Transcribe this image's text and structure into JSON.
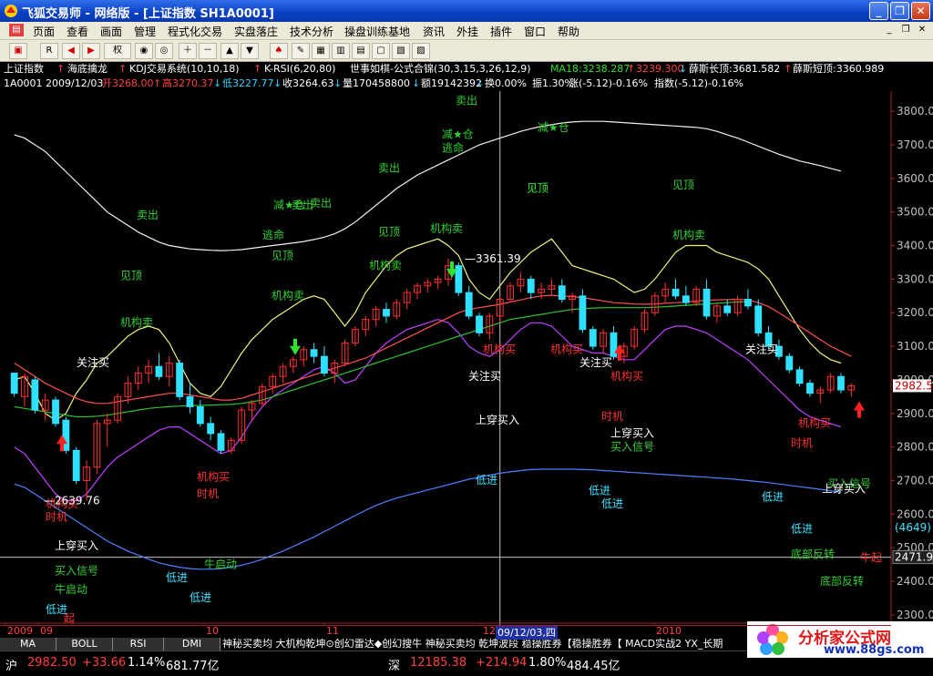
{
  "window": {
    "title": "飞狐交易师 - 网络版 - [上证指数 SH1A0001]"
  },
  "menu": [
    "页面",
    "查看",
    "画面",
    "管理",
    "程式化交易",
    "实盘落庄",
    "技术分析",
    "操盘训练基地",
    "资讯",
    "外挂",
    "插件",
    "窗口",
    "帮助"
  ],
  "toolbar": {
    "quote_mode": "权"
  },
  "header": {
    "name": "上证指数",
    "indicators": [
      "海底擒龙",
      "KDJ交易系统(10,10,18)",
      "K-RSI(6,20,80)",
      "世事如棋-公式合锦(30,3,15,3,26,12,9)"
    ],
    "ma18_label": "MA18:3238.287",
    "ma_value2": "3239.300",
    "xue_long_label": "薛斯长顶:3681.582",
    "xue_short_label": "薛斯短顶:3360.989"
  },
  "quote": {
    "code_date": "1A0001 2009/12/03",
    "open_label": "开3268.00",
    "high_label": "高3270.37",
    "low_label": "低3227.77",
    "close_label": "收3264.63",
    "volume_label": "量170458800",
    "amount_label": "额19142392",
    "turnover_label": "换0.00%",
    "amplitude_label": "振1.30%",
    "change_label": "涨(-5.12)-0.16%",
    "index_label": "指数(-5.12)-0.16%"
  },
  "price_axis": {
    "ticks": [
      "3800.00",
      "3700.00",
      "3600.00",
      "3500.00",
      "3400.00",
      "3300.00",
      "3200.00",
      "3100.00",
      "3000.00",
      "2900.00",
      "2800.00",
      "2700.00",
      "2600.00",
      "2500.00",
      "2400.00",
      "2300.00"
    ],
    "last_price": "2982.5",
    "crosshair_value": "2471.91",
    "aux_label": "(4649)"
  },
  "time_axis": {
    "labels": [
      "2009",
      "09",
      "10",
      "11",
      "12",
      "2010"
    ],
    "cursor_label": "09/12/03,四"
  },
  "annotations": {
    "peak_price": "3361.39",
    "low_price": "2639.76",
    "green": [
      "卖出",
      "卖出",
      "减★仓",
      "逃命",
      "减★仓",
      "卖出",
      "卖出",
      "卖出",
      "减★仓",
      "逃命",
      "见顶",
      "见顶",
      "见顶",
      "机构卖",
      "见顶",
      "机构卖",
      "机构卖",
      "机构卖",
      "机构卖",
      "见顶",
      "见顶",
      "买入信号",
      "牛启动",
      "牛启动",
      "买入信号",
      "底部反转",
      "底部反转",
      "买入信号"
    ],
    "red": [
      "机构买",
      "时机",
      "机构买",
      "时机",
      "机构买",
      "机构买",
      "机构买",
      "时机",
      "机构买",
      "时机",
      "牛起",
      "起"
    ],
    "white": [
      "关注买",
      "关注买",
      "关注买",
      "关注买",
      "上穿买入",
      "上穿买入",
      "上穿买入",
      "上穿买入"
    ],
    "cyan": [
      "低进",
      "低进",
      "低进",
      "低进",
      "低进",
      "低进",
      "低进",
      "低进"
    ]
  },
  "chart_data": {
    "type": "candlestick",
    "note_series": [
      "K线",
      "MA18",
      "薛斯长顶",
      "薛斯短顶"
    ],
    "points": [
      {
        "o": 3020,
        "h": 3000,
        "l": 2950,
        "c": 2960
      },
      {
        "o": 2950,
        "h": 3020,
        "l": 2920,
        "c": 3010
      },
      {
        "o": 3000,
        "h": 3010,
        "l": 2900,
        "c": 2910
      },
      {
        "o": 2910,
        "h": 2960,
        "l": 2880,
        "c": 2940
      },
      {
        "o": 2940,
        "h": 2950,
        "l": 2860,
        "c": 2870
      },
      {
        "o": 2880,
        "h": 2890,
        "l": 2780,
        "c": 2790
      },
      {
        "o": 2790,
        "h": 2800,
        "l": 2690,
        "c": 2700
      },
      {
        "o": 2700,
        "h": 2760,
        "l": 2640,
        "c": 2740
      },
      {
        "o": 2740,
        "h": 2880,
        "l": 2720,
        "c": 2870
      },
      {
        "o": 2870,
        "h": 2900,
        "l": 2800,
        "c": 2880
      },
      {
        "o": 2880,
        "h": 2960,
        "l": 2870,
        "c": 2950
      },
      {
        "o": 2950,
        "h": 3010,
        "l": 2930,
        "c": 2990
      },
      {
        "o": 2990,
        "h": 3040,
        "l": 2970,
        "c": 3020
      },
      {
        "o": 3020,
        "h": 3060,
        "l": 2990,
        "c": 3040
      },
      {
        "o": 3040,
        "h": 3080,
        "l": 3000,
        "c": 3010
      },
      {
        "o": 3010,
        "h": 3070,
        "l": 2980,
        "c": 3050
      },
      {
        "o": 3050,
        "h": 3060,
        "l": 2940,
        "c": 2950
      },
      {
        "o": 2950,
        "h": 2990,
        "l": 2900,
        "c": 2920
      },
      {
        "o": 2920,
        "h": 2940,
        "l": 2860,
        "c": 2870
      },
      {
        "o": 2870,
        "h": 2890,
        "l": 2820,
        "c": 2840
      },
      {
        "o": 2840,
        "h": 2850,
        "l": 2780,
        "c": 2790
      },
      {
        "o": 2790,
        "h": 2830,
        "l": 2780,
        "c": 2820
      },
      {
        "o": 2820,
        "h": 2920,
        "l": 2810,
        "c": 2910
      },
      {
        "o": 2910,
        "h": 2940,
        "l": 2880,
        "c": 2930
      },
      {
        "o": 2930,
        "h": 2990,
        "l": 2920,
        "c": 2980
      },
      {
        "o": 2980,
        "h": 3020,
        "l": 2960,
        "c": 3010
      },
      {
        "o": 3010,
        "h": 3050,
        "l": 2990,
        "c": 3040
      },
      {
        "o": 3040,
        "h": 3070,
        "l": 3020,
        "c": 3060
      },
      {
        "o": 3060,
        "h": 3100,
        "l": 3040,
        "c": 3090
      },
      {
        "o": 3090,
        "h": 3110,
        "l": 3050,
        "c": 3070
      },
      {
        "o": 3070,
        "h": 3100,
        "l": 3010,
        "c": 3020
      },
      {
        "o": 3020,
        "h": 3060,
        "l": 2990,
        "c": 3050
      },
      {
        "o": 3050,
        "h": 3120,
        "l": 3040,
        "c": 3110
      },
      {
        "o": 3110,
        "h": 3160,
        "l": 3100,
        "c": 3150
      },
      {
        "o": 3150,
        "h": 3190,
        "l": 3130,
        "c": 3180
      },
      {
        "o": 3180,
        "h": 3220,
        "l": 3160,
        "c": 3210
      },
      {
        "o": 3210,
        "h": 3230,
        "l": 3170,
        "c": 3190
      },
      {
        "o": 3190,
        "h": 3240,
        "l": 3180,
        "c": 3230
      },
      {
        "o": 3230,
        "h": 3270,
        "l": 3210,
        "c": 3260
      },
      {
        "o": 3260,
        "h": 3290,
        "l": 3240,
        "c": 3280
      },
      {
        "o": 3280,
        "h": 3300,
        "l": 3260,
        "c": 3290
      },
      {
        "o": 3290,
        "h": 3310,
        "l": 3270,
        "c": 3300
      },
      {
        "o": 3300,
        "h": 3361,
        "l": 3280,
        "c": 3340
      },
      {
        "o": 3340,
        "h": 3350,
        "l": 3250,
        "c": 3260
      },
      {
        "o": 3260,
        "h": 3280,
        "l": 3180,
        "c": 3190
      },
      {
        "o": 3190,
        "h": 3200,
        "l": 3130,
        "c": 3140
      },
      {
        "o": 3140,
        "h": 3200,
        "l": 3120,
        "c": 3190
      },
      {
        "o": 3190,
        "h": 3250,
        "l": 3170,
        "c": 3240
      },
      {
        "o": 3240,
        "h": 3290,
        "l": 3230,
        "c": 3280
      },
      {
        "o": 3280,
        "h": 3320,
        "l": 3260,
        "c": 3300
      },
      {
        "o": 3300,
        "h": 3310,
        "l": 3240,
        "c": 3260
      },
      {
        "o": 3260,
        "h": 3290,
        "l": 3240,
        "c": 3270
      },
      {
        "o": 3270,
        "h": 3300,
        "l": 3250,
        "c": 3280
      },
      {
        "o": 3280,
        "h": 3300,
        "l": 3230,
        "c": 3240
      },
      {
        "o": 3240,
        "h": 3260,
        "l": 3200,
        "c": 3250
      },
      {
        "o": 3250,
        "h": 3270,
        "l": 3140,
        "c": 3150
      },
      {
        "o": 3150,
        "h": 3160,
        "l": 3090,
        "c": 3100
      },
      {
        "o": 3100,
        "h": 3150,
        "l": 3080,
        "c": 3140
      },
      {
        "o": 3140,
        "h": 3160,
        "l": 3060,
        "c": 3070
      },
      {
        "o": 3070,
        "h": 3110,
        "l": 3050,
        "c": 3100
      },
      {
        "o": 3100,
        "h": 3160,
        "l": 3090,
        "c": 3150
      },
      {
        "o": 3150,
        "h": 3210,
        "l": 3140,
        "c": 3200
      },
      {
        "o": 3200,
        "h": 3260,
        "l": 3190,
        "c": 3250
      },
      {
        "o": 3250,
        "h": 3290,
        "l": 3230,
        "c": 3270
      },
      {
        "o": 3270,
        "h": 3300,
        "l": 3240,
        "c": 3250
      },
      {
        "o": 3250,
        "h": 3280,
        "l": 3220,
        "c": 3230
      },
      {
        "o": 3230,
        "h": 3280,
        "l": 3220,
        "c": 3270
      },
      {
        "o": 3270,
        "h": 3300,
        "l": 3180,
        "c": 3190
      },
      {
        "o": 3190,
        "h": 3230,
        "l": 3170,
        "c": 3220
      },
      {
        "o": 3220,
        "h": 3240,
        "l": 3190,
        "c": 3200
      },
      {
        "o": 3200,
        "h": 3250,
        "l": 3190,
        "c": 3240
      },
      {
        "o": 3240,
        "h": 3270,
        "l": 3210,
        "c": 3220
      },
      {
        "o": 3220,
        "h": 3240,
        "l": 3130,
        "c": 3140
      },
      {
        "o": 3140,
        "h": 3160,
        "l": 3090,
        "c": 3100
      },
      {
        "o": 3100,
        "h": 3120,
        "l": 3060,
        "c": 3070
      },
      {
        "o": 3070,
        "h": 3080,
        "l": 3020,
        "c": 3030
      },
      {
        "o": 3030,
        "h": 3040,
        "l": 2980,
        "c": 2990
      },
      {
        "o": 2990,
        "h": 3000,
        "l": 2950,
        "c": 2960
      },
      {
        "o": 2960,
        "h": 2980,
        "l": 2930,
        "c": 2970
      },
      {
        "o": 2970,
        "h": 3020,
        "l": 2960,
        "c": 3010
      },
      {
        "o": 3010,
        "h": 3020,
        "l": 2960,
        "c": 2970
      },
      {
        "o": 2970,
        "h": 2990,
        "l": 2950,
        "c": 2982
      }
    ],
    "ma18": [
      3050,
      3030,
      3010,
      2990,
      2975,
      2960,
      2945,
      2935,
      2930,
      2930,
      2935,
      2940,
      2945,
      2950,
      2955,
      2960,
      2960,
      2955,
      2950,
      2945,
      2940,
      2940,
      2945,
      2955,
      2965,
      2975,
      2985,
      2995,
      3005,
      3015,
      3025,
      3035,
      3045,
      3055,
      3065,
      3080,
      3095,
      3110,
      3125,
      3140,
      3155,
      3170,
      3185,
      3200,
      3210,
      3215,
      3220,
      3225,
      3232,
      3238,
      3245,
      3250,
      3252,
      3250,
      3248,
      3245,
      3240,
      3235,
      3230,
      3228,
      3226,
      3225,
      3226,
      3228,
      3230,
      3232,
      3235,
      3237,
      3238,
      3239,
      3240,
      3238,
      3230,
      3218,
      3200,
      3180,
      3160,
      3140,
      3120,
      3100,
      3085,
      3070
    ],
    "mid_line": [
      2920,
      2915,
      2910,
      2905,
      2900,
      2895,
      2890,
      2890,
      2892,
      2895,
      2900,
      2905,
      2910,
      2915,
      2918,
      2920,
      2922,
      2923,
      2924,
      2925,
      2926,
      2927,
      2930,
      2935,
      2940,
      2950,
      2960,
      2970,
      2980,
      2990,
      3000,
      3010,
      3020,
      3030,
      3040,
      3050,
      3060,
      3070,
      3080,
      3090,
      3100,
      3110,
      3120,
      3130,
      3140,
      3150,
      3160,
      3170,
      3180,
      3185,
      3190,
      3195,
      3200,
      3205,
      3210,
      3212,
      3214,
      3215,
      3215,
      3215,
      3215,
      3215,
      3216,
      3218,
      3220,
      3222,
      3224,
      3226,
      3228,
      3230,
      3232,
      3233
    ],
    "long_top": [
      3730,
      3720,
      3700,
      3680,
      3650,
      3620,
      3590,
      3560,
      3530,
      3500,
      3480,
      3460,
      3440,
      3425,
      3410,
      3400,
      3395,
      3390,
      3388,
      3386,
      3385,
      3386,
      3388,
      3392,
      3396,
      3400,
      3404,
      3408,
      3412,
      3418,
      3425,
      3435,
      3450,
      3470,
      3495,
      3520,
      3545,
      3570,
      3590,
      3610,
      3625,
      3640,
      3655,
      3670,
      3685,
      3700,
      3710,
      3720,
      3730,
      3740,
      3748,
      3755,
      3760,
      3765,
      3768,
      3770,
      3770,
      3770,
      3768,
      3766,
      3764,
      3762,
      3760,
      3758,
      3756,
      3754,
      3752,
      3748,
      3740,
      3730,
      3720,
      3708,
      3696,
      3684,
      3672,
      3662,
      3652,
      3645,
      3638,
      3630,
      3622
    ],
    "short_top": [
      3000,
      3010,
      2960,
      2900,
      2880,
      2900,
      2960,
      3000,
      3050,
      3070,
      3100,
      3130,
      3150,
      3160,
      3150,
      3110,
      3050,
      2990,
      2960,
      2950,
      2980,
      3030,
      3080,
      3120,
      3150,
      3180,
      3200,
      3220,
      3240,
      3250,
      3240,
      3200,
      3160,
      3200,
      3260,
      3300,
      3340,
      3370,
      3390,
      3400,
      3410,
      3420,
      3400,
      3370,
      3300,
      3260,
      3240,
      3280,
      3320,
      3350,
      3380,
      3400,
      3420,
      3380,
      3340,
      3330,
      3320,
      3310,
      3300,
      3280,
      3260,
      3270,
      3300,
      3340,
      3380,
      3400,
      3400,
      3400,
      3380,
      3370,
      3360,
      3350,
      3330,
      3300,
      3250,
      3200,
      3150,
      3110,
      3080,
      3060,
      3050
    ],
    "lower_band": [
      2800,
      2780,
      2740,
      2700,
      2660,
      2640,
      2640,
      2660,
      2700,
      2740,
      2770,
      2790,
      2810,
      2830,
      2850,
      2860,
      2860,
      2840,
      2820,
      2800,
      2780,
      2790,
      2830,
      2880,
      2920,
      2950,
      2970,
      2990,
      3010,
      3030,
      3040,
      3020,
      2990,
      3000,
      3040,
      3080,
      3110,
      3130,
      3150,
      3160,
      3170,
      3180,
      3170,
      3140,
      3100,
      3080,
      3070,
      3090,
      3120,
      3150,
      3170,
      3170,
      3160,
      3130,
      3100,
      3090,
      3080,
      3080,
      3070,
      3060,
      3060,
      3090,
      3120,
      3150,
      3160,
      3160,
      3150,
      3140,
      3120,
      3100,
      3080,
      3060,
      3030,
      3000,
      2970,
      2940,
      2910,
      2890,
      2880,
      2870,
      2860
    ],
    "volume_line": [
      2690,
      2680,
      2660,
      2640,
      2620,
      2600,
      2580,
      2560,
      2540,
      2520,
      2505,
      2490,
      2478,
      2466,
      2455,
      2448,
      2442,
      2438,
      2436,
      2436,
      2438,
      2442,
      2448,
      2456,
      2466,
      2478,
      2490,
      2504,
      2518,
      2532,
      2548,
      2564,
      2580,
      2596,
      2612,
      2626,
      2638,
      2648,
      2656,
      2664,
      2672,
      2680,
      2688,
      2696,
      2704,
      2710,
      2716,
      2722,
      2726,
      2730,
      2733,
      2734,
      2734,
      2734,
      2734,
      2733,
      2732,
      2730,
      2728,
      2726,
      2724,
      2722,
      2720,
      2718,
      2716,
      2714,
      2712,
      2710,
      2708,
      2706,
      2703,
      2700,
      2697,
      2694,
      2690,
      2686,
      2682,
      2678,
      2674,
      2670,
      2665
    ],
    "y_min": 2270,
    "y_max": 3860
  },
  "bottom_tabs": [
    "MA",
    "BOLL",
    "RSI",
    "DMI"
  ],
  "bottom_strip": "神秘买卖均 大机构乾坤⊙创幻雷达◆创幻搜牛 神秘买卖均 乾坤波段 稳操胜券【稳操胜券【 MACD实战2 YX_长期",
  "status": {
    "sh_label": "沪",
    "sh_price": "2982.50",
    "sh_change": "+33.66",
    "sh_pct": "1.14%",
    "sh_amount": "681.77亿",
    "sz_label": "深",
    "sz_price": "12185.38",
    "sz_change": "+214.94",
    "sz_pct": "1.80%",
    "sz_amount": "484.45亿"
  },
  "watermark": {
    "title": "分析家公式网",
    "url": "www.88gs.com"
  },
  "colors": {
    "up": "#ff3030",
    "down": "#30e0ff",
    "label_green": "#30d030",
    "label_red": "#ff3030",
    "ma18": "#ff5050",
    "mid": "#30c030",
    "long_top": "#f0f0f0",
    "short_top": "#f0f080",
    "lower_band": "#c040ff",
    "vol_line": "#5080ff"
  }
}
